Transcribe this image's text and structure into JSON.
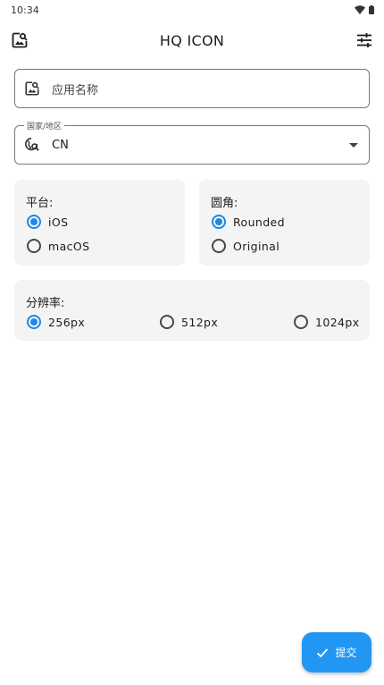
{
  "status_bar": {
    "time": "10:34",
    "icons": [
      "wifi-icon",
      "battery-icon"
    ]
  },
  "app_bar": {
    "title": "HQ ICON",
    "left_icon": "image-search-icon",
    "right_icon": "tune-icon"
  },
  "name_field": {
    "placeholder": "应用名称",
    "icon": "image-search-icon"
  },
  "country_field": {
    "label": "国家/地区",
    "value": "CN",
    "icon": "globe-search-icon",
    "trailing_icon": "dropdown-arrow-icon"
  },
  "platform": {
    "label": "平台:",
    "options": [
      "iOS",
      "macOS"
    ],
    "selected": "iOS"
  },
  "corner": {
    "label": "圆角:",
    "options": [
      "Rounded",
      "Original"
    ],
    "selected": "Rounded"
  },
  "resolution": {
    "label": "分辨率:",
    "options": [
      "256px",
      "512px",
      "1024px"
    ],
    "selected": "256px"
  },
  "submit": {
    "label": "提交",
    "icon": "check-icon"
  },
  "colors": {
    "accent": "#1e88e5",
    "fab": "#2196f3",
    "card_bg": "#f4f4f4",
    "outline": "#79747e"
  }
}
